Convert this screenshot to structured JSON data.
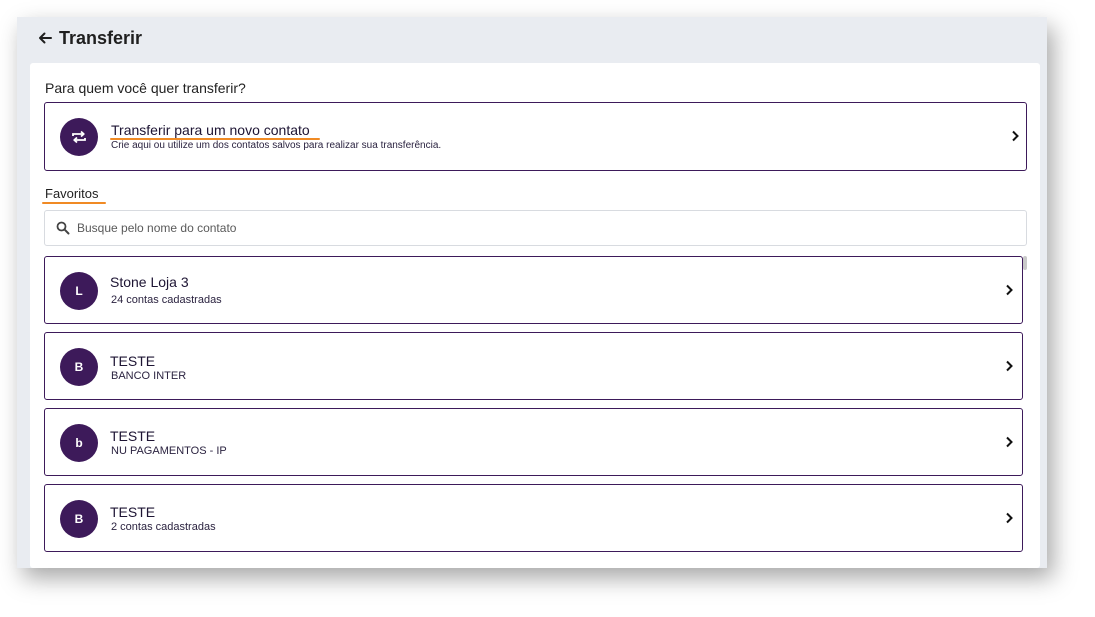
{
  "header": {
    "title": "Transferir",
    "back_icon": "arrow-left-icon"
  },
  "question": "Para quem você quer transferir?",
  "new_contact": {
    "title": "Transferir para um novo contato",
    "subtitle": "Crie aqui ou utilize um dos contatos salvos para realizar sua transferência.",
    "icon": "transfer-arrows-icon"
  },
  "favorites": {
    "label": "Favoritos",
    "search_placeholder": "Busque pelo nome do contato",
    "search_value": ""
  },
  "contacts": [
    {
      "initial": "L",
      "name": "Stone Loja 3",
      "detail": "24 contas cadastradas"
    },
    {
      "initial": "B",
      "name": "TESTE",
      "detail": "BANCO INTER"
    },
    {
      "initial": "b",
      "name": "TESTE",
      "detail": "NU PAGAMENTOS - IP"
    },
    {
      "initial": "B",
      "name": "TESTE",
      "detail": "2 contas cadastradas"
    }
  ],
  "colors": {
    "primary": "#3d1a5a",
    "accent_underline": "#f08a24",
    "background": "#e9ecf1"
  }
}
